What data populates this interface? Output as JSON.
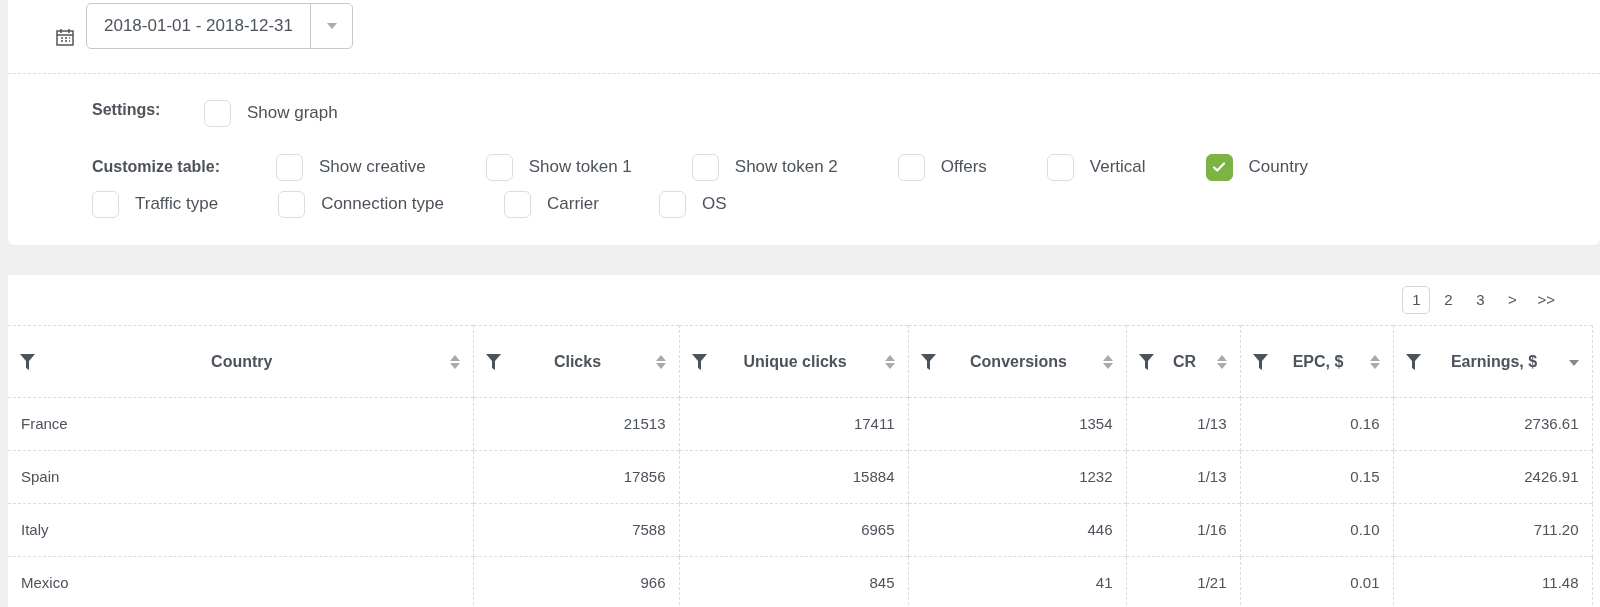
{
  "date_range": {
    "value": "2018-01-01 - 2018-12-31"
  },
  "settings": {
    "label": "Settings:",
    "options": [
      {
        "label": "Show graph",
        "checked": false
      }
    ]
  },
  "customize_table": {
    "label": "Customize table:",
    "options": [
      {
        "label": "Show creative",
        "checked": false
      },
      {
        "label": "Show token 1",
        "checked": false
      },
      {
        "label": "Show token 2",
        "checked": false
      },
      {
        "label": "Offers",
        "checked": false
      },
      {
        "label": "Vertical",
        "checked": false
      },
      {
        "label": "Country",
        "checked": true
      },
      {
        "label": "Traffic type",
        "checked": false
      },
      {
        "label": "Connection type",
        "checked": false
      },
      {
        "label": "Carrier",
        "checked": false
      },
      {
        "label": "OS",
        "checked": false
      }
    ]
  },
  "pagination": [
    {
      "label": "1",
      "selected": true
    },
    {
      "label": "2",
      "selected": false
    },
    {
      "label": "3",
      "selected": false
    },
    {
      "label": ">",
      "selected": false
    },
    {
      "label": ">>",
      "selected": false
    }
  ],
  "table": {
    "columns": [
      {
        "label": "Country",
        "sorted": false
      },
      {
        "label": "Clicks",
        "sorted": false
      },
      {
        "label": "Unique clicks",
        "sorted": false
      },
      {
        "label": "Conversions",
        "sorted": false
      },
      {
        "label": "CR",
        "sorted": false
      },
      {
        "label": "EPC, $",
        "sorted": false
      },
      {
        "label": "Earnings, $",
        "sorted": true
      }
    ],
    "rows": [
      [
        "France",
        "21513",
        "17411",
        "1354",
        "1/13",
        "0.16",
        "2736.61"
      ],
      [
        "Spain",
        "17856",
        "15884",
        "1232",
        "1/13",
        "0.15",
        "2426.91"
      ],
      [
        "Italy",
        "7588",
        "6965",
        "446",
        "1/16",
        "0.10",
        "711.20"
      ],
      [
        "Mexico",
        "966",
        "845",
        "41",
        "1/21",
        "0.01",
        "11.48"
      ]
    ]
  }
}
